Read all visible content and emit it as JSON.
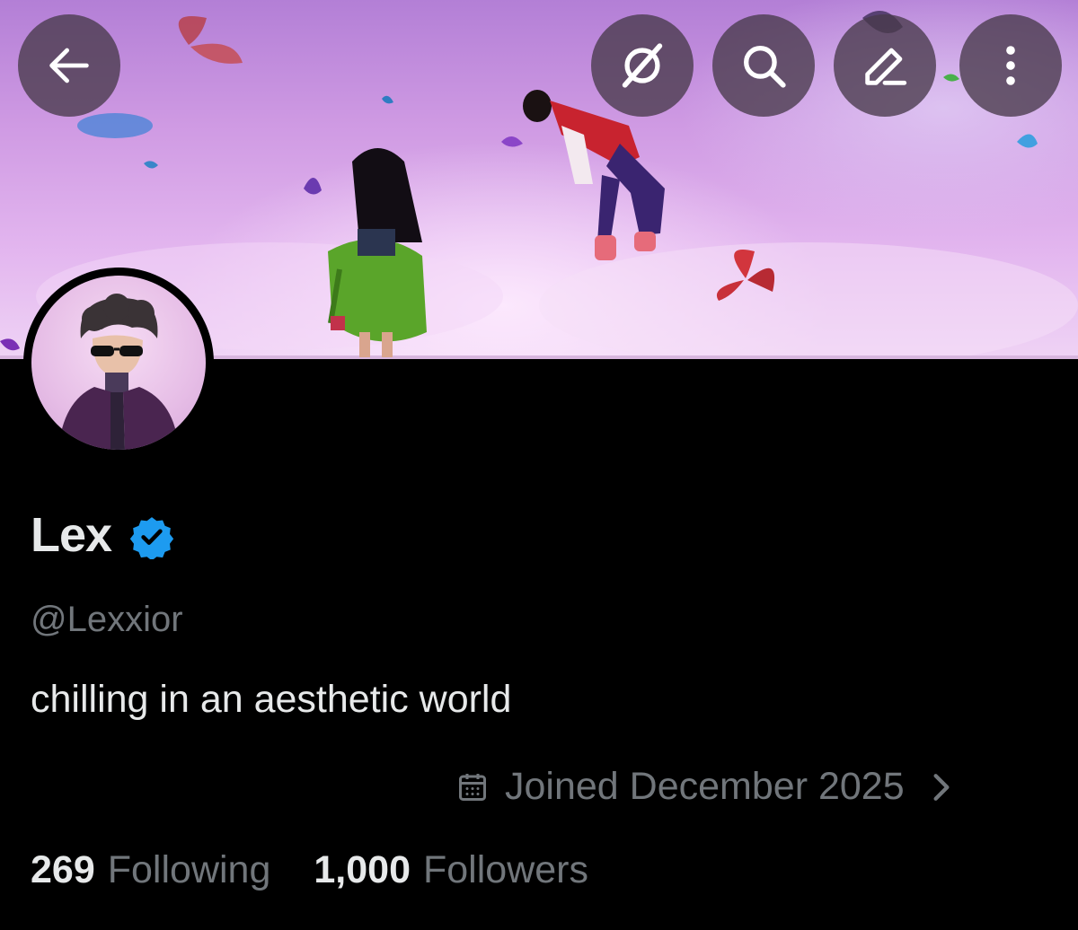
{
  "profile": {
    "display_name": "Lex",
    "handle": "@Lexxior",
    "bio": "chilling in an aesthetic world",
    "joined": "Joined December 2025",
    "following_count": "269",
    "following_label": "Following",
    "followers_count": "1,000",
    "followers_label": "Followers",
    "verified": true
  },
  "header_buttons": [
    {
      "name": "back",
      "icon": "arrow-left-icon"
    },
    {
      "name": "grok",
      "icon": "grok-icon"
    },
    {
      "name": "search",
      "icon": "search-icon"
    },
    {
      "name": "edit",
      "icon": "pencil-icon"
    },
    {
      "name": "more",
      "icon": "more-vertical-icon"
    }
  ],
  "colors": {
    "background": "#000000",
    "primary_text": "#e7e9ea",
    "secondary_text": "#71767b",
    "verified_badge": "#1d9bf0",
    "header_button_bg": "#483a4a"
  }
}
